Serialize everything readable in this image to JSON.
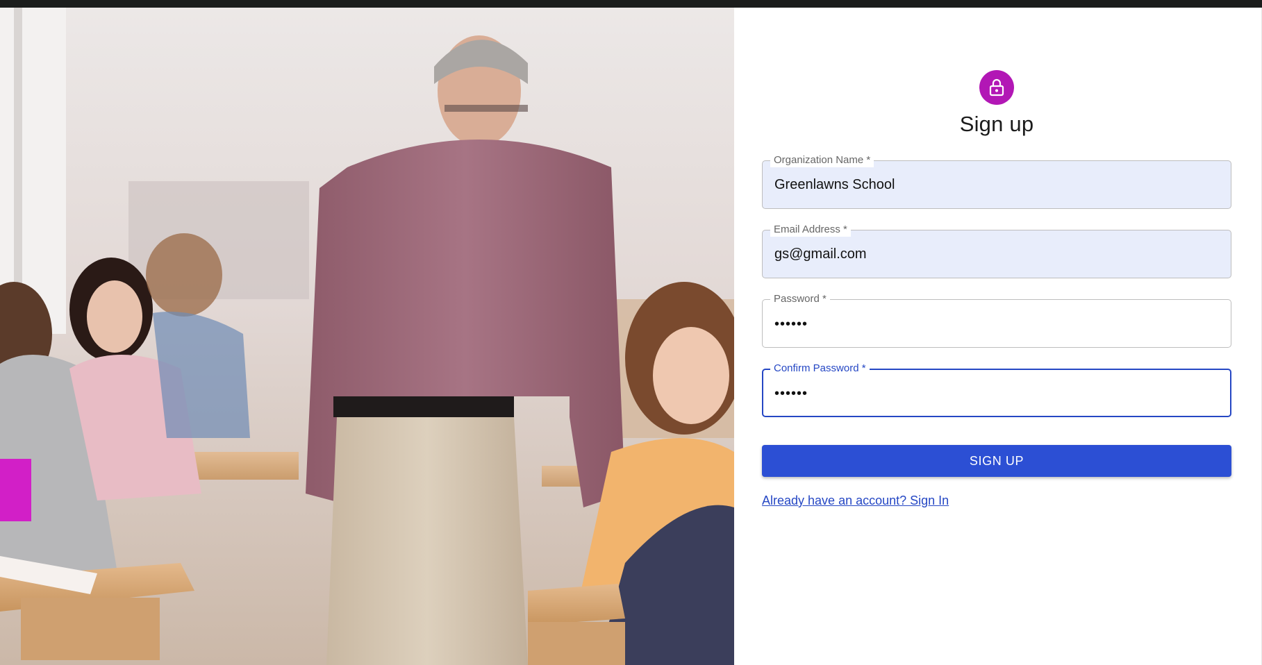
{
  "form": {
    "title": "Sign up",
    "fields": [
      {
        "label": "Organization Name *",
        "value": "Greenlawns School",
        "state": "autofilled"
      },
      {
        "label": "Email Address *",
        "value": "gs@gmail.com",
        "state": "autofilled"
      },
      {
        "label": "Password *",
        "value": "••••••",
        "state": "default"
      },
      {
        "label": "Confirm Password *",
        "value": "••••••",
        "state": "focused"
      }
    ],
    "submit_label": "SIGN UP",
    "signin_link": "Already have an account? Sign In"
  },
  "icons": {
    "avatar": "lock-icon"
  },
  "colors": {
    "avatar_bg": "#b217b5",
    "primary": "#2c4fd4",
    "autofill_bg": "#e8edfb",
    "focus_border": "#2547c4"
  }
}
